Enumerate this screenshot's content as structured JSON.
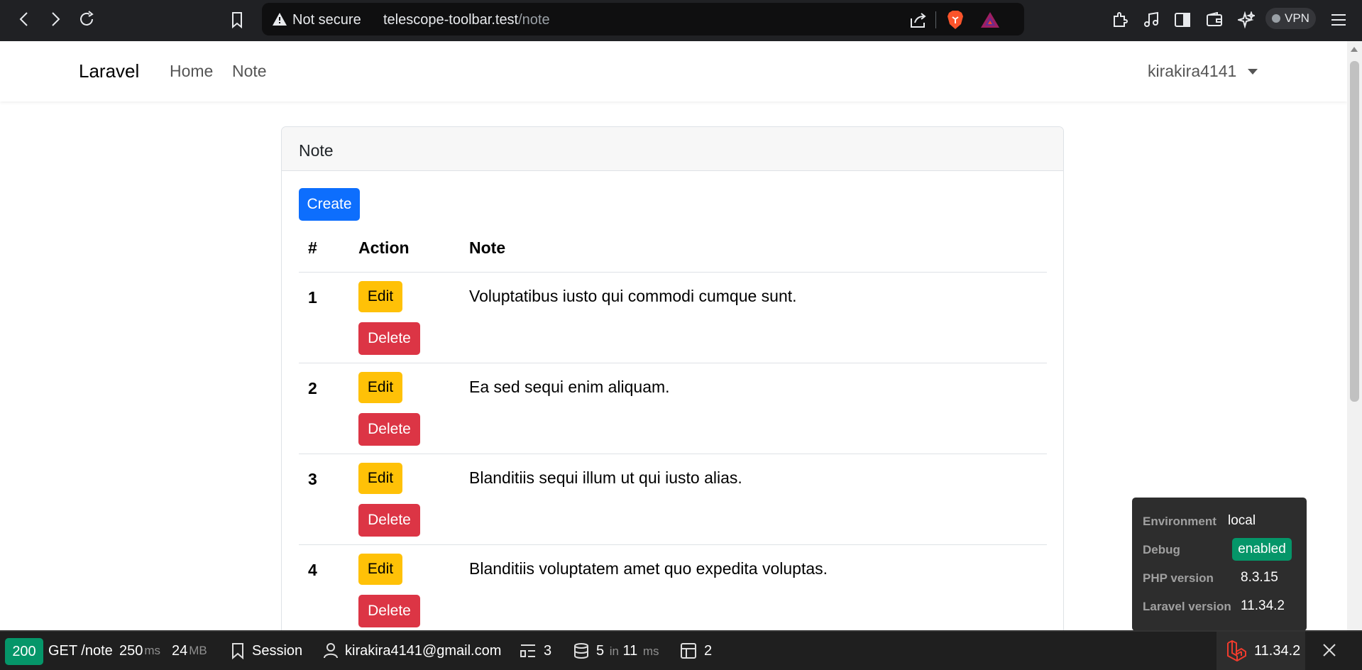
{
  "browser": {
    "security_label": "Not secure",
    "url_host": "telescope-toolbar.test",
    "url_path": "/note",
    "vpn_label": "VPN"
  },
  "navbar": {
    "brand": "Laravel",
    "links": [
      "Home",
      "Note"
    ],
    "user": "kirakira4141"
  },
  "card": {
    "title": "Note",
    "create_label": "Create",
    "columns": [
      "#",
      "Action",
      "Note"
    ],
    "edit_label": "Edit",
    "delete_label": "Delete",
    "rows": [
      {
        "id": "1",
        "note": "Voluptatibus iusto qui commodi cumque sunt."
      },
      {
        "id": "2",
        "note": "Ea sed sequi enim aliquam."
      },
      {
        "id": "3",
        "note": "Blanditiis sequi illum ut qui iusto alias."
      },
      {
        "id": "4",
        "note": "Blanditiis voluptatem amet quo expedita voluptas."
      }
    ]
  },
  "telescope_popup": {
    "environment_label": "Environment",
    "environment_value": "local",
    "debug_label": "Debug",
    "debug_value": "enabled",
    "php_label": "PHP version",
    "php_value": "8.3.15",
    "laravel_label": "Laravel version",
    "laravel_value": "11.34.2"
  },
  "toolbar": {
    "status": "200",
    "request": "GET /note",
    "duration": "250",
    "duration_unit": "ms",
    "memory": "24",
    "memory_unit": "MB",
    "session": "Session",
    "user_email": "kirakira4141@gmail.com",
    "views_count": "3",
    "queries_count": "5",
    "queries_in": "in",
    "queries_time": "11",
    "queries_unit": "ms",
    "models_count": "2",
    "laravel_version": "11.34.2"
  },
  "colors": {
    "primary": "#0d6efd",
    "warning": "#ffc107",
    "danger": "#dc3545",
    "success": "#059669"
  }
}
